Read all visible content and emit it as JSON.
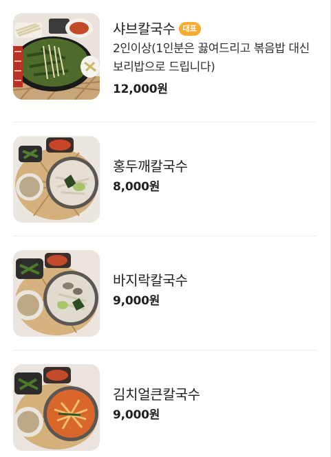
{
  "menu": {
    "items": [
      {
        "name": "샤브칼국수",
        "badge": "대표",
        "description": "2인이상(1인분은 끓여드리고 볶음밥 대신 보리밥으로 드립니다)",
        "price": "12,000원",
        "image": "shabu-kalguksu-photo"
      },
      {
        "name": "홍두깨칼국수",
        "price": "8,000원",
        "image": "hongdukkae-kalguksu-photo"
      },
      {
        "name": "바지락칼국수",
        "price": "9,000원",
        "image": "bajirak-kalguksu-photo"
      },
      {
        "name": "김치얼큰칼국수",
        "price": "9,000원",
        "image": "kimchi-eolkeun-kalguksu-photo"
      }
    ]
  }
}
